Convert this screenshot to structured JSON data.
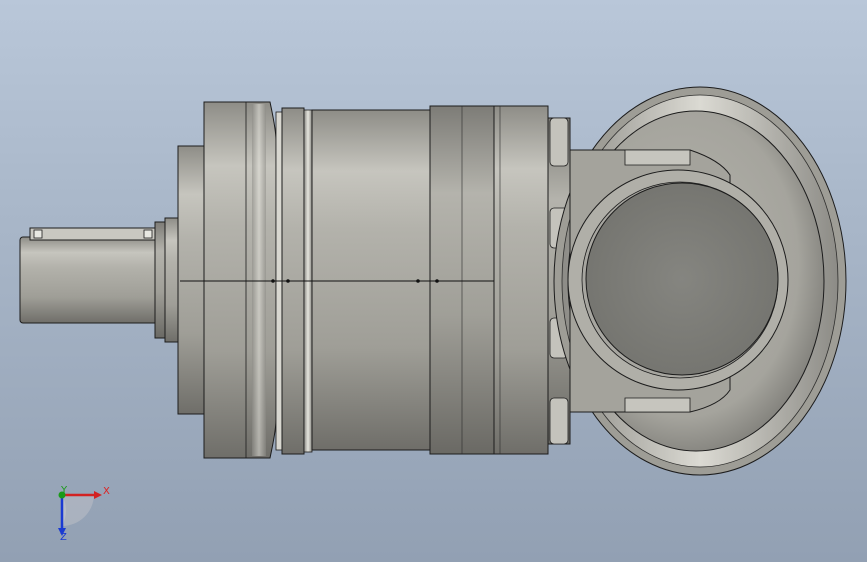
{
  "viewport": {
    "background_top": "#b9c7d9",
    "background_bottom": "#92a0b3"
  },
  "model": {
    "icon": "gear-reducer-3d-model-icon",
    "body_color": "#a7a69f",
    "edge_color": "#1c1c1c",
    "bore_color": "#7e7e7c"
  },
  "triad": {
    "icon": "coordinate-axis-triad-icon",
    "x_label": "X",
    "y_label": "Y",
    "z_label": "Z",
    "x_color": "#d22222",
    "y_color": "#1a9a1a",
    "z_color": "#1a3ad2"
  }
}
